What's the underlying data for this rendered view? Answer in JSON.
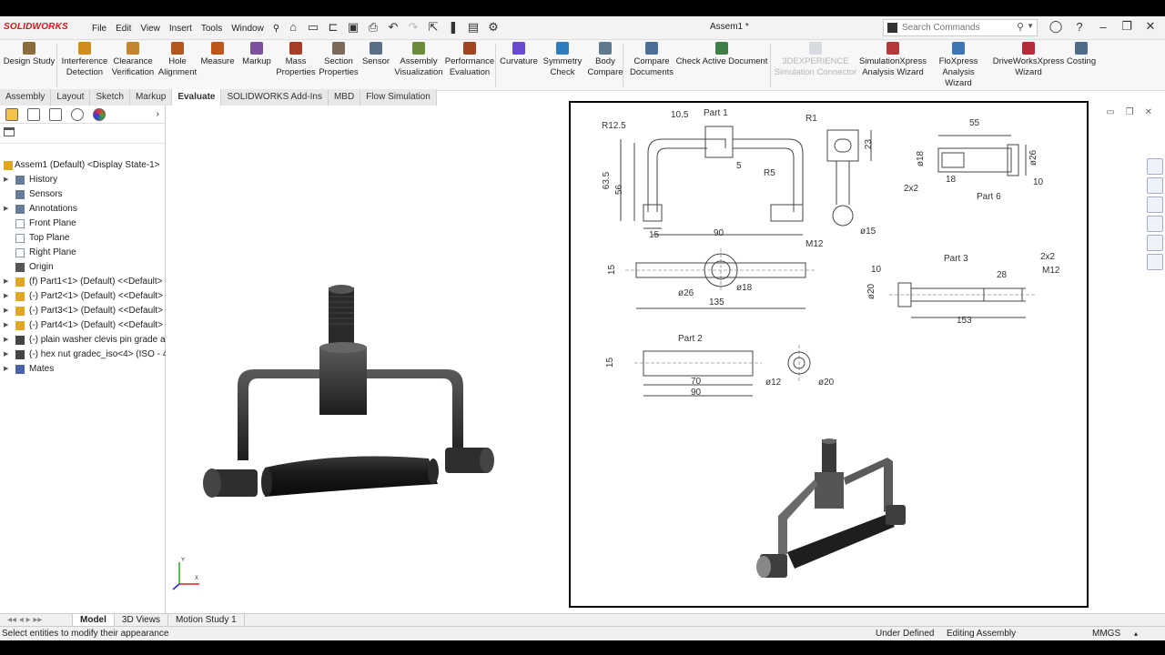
{
  "app": {
    "brand": "SOLIDWORKS",
    "document_title": "Assem1 *"
  },
  "menus": [
    "File",
    "Edit",
    "View",
    "Insert",
    "Tools",
    "Window"
  ],
  "search": {
    "placeholder": "Search Commands"
  },
  "commands": [
    {
      "label": "Design Study",
      "color": "#8a6d3b"
    },
    {
      "label": "Interference Detection",
      "color": "#d08a1e"
    },
    {
      "label": "Clearance Verification",
      "color": "#c4862a"
    },
    {
      "label": "Hole Alignment",
      "color": "#b2571e"
    },
    {
      "label": "Measure",
      "color": "#c0561a"
    },
    {
      "label": "Markup",
      "color": "#7e4f9e"
    },
    {
      "label": "Mass Properties",
      "color": "#aa3b24"
    },
    {
      "label": "Section Properties",
      "color": "#7b6a5b"
    },
    {
      "label": "Sensor",
      "color": "#5a6f85"
    },
    {
      "label": "Assembly Visualization",
      "color": "#6c8c3c"
    },
    {
      "label": "Performance Evaluation",
      "color": "#a04520"
    },
    {
      "label": "Curvature",
      "color": "#6a4ad0"
    },
    {
      "label": "Symmetry Check",
      "color": "#2e7dbf"
    },
    {
      "label": "Body Compare",
      "color": "#5f7a8e"
    },
    {
      "label": "Compare Documents",
      "color": "#4b6e99"
    },
    {
      "label": "Check Active Document",
      "color": "#3f7e45"
    },
    {
      "label": "3DEXPERIENCE Simulation Connector",
      "color": "#9aa7b5",
      "disabled": true
    },
    {
      "label": "SimulationXpress Analysis Wizard",
      "color": "#b43a3a"
    },
    {
      "label": "FloXpress Analysis Wizard",
      "color": "#3a77b4"
    },
    {
      "label": "DriveWorksXpress Wizard",
      "color": "#b42c3a"
    },
    {
      "label": "Costing",
      "color": "#4e6b8a"
    }
  ],
  "tabs": [
    "Assembly",
    "Layout",
    "Sketch",
    "Markup",
    "Evaluate",
    "SOLIDWORKS Add-Ins",
    "MBD",
    "Flow Simulation"
  ],
  "active_tab": "Evaluate",
  "tree": [
    {
      "label": "Assem1 (Default) <Display State-1>",
      "indent": 0,
      "arrow": false,
      "icon": "assembly-icon"
    },
    {
      "label": "History",
      "indent": 1,
      "arrow": true,
      "icon": "history-icon"
    },
    {
      "label": "Sensors",
      "indent": 1,
      "arrow": false,
      "icon": "sensors-icon"
    },
    {
      "label": "Annotations",
      "indent": 1,
      "arrow": true,
      "icon": "annotations-icon"
    },
    {
      "label": "Front Plane",
      "indent": 1,
      "arrow": false,
      "icon": "plane-icon"
    },
    {
      "label": "Top Plane",
      "indent": 1,
      "arrow": false,
      "icon": "plane-icon"
    },
    {
      "label": "Right Plane",
      "indent": 1,
      "arrow": false,
      "icon": "plane-icon"
    },
    {
      "label": "Origin",
      "indent": 1,
      "arrow": false,
      "icon": "origin-icon"
    },
    {
      "label": "(f) Part1<1> (Default) <<Default>",
      "indent": 1,
      "arrow": true,
      "icon": "part-icon"
    },
    {
      "label": "(-) Part2<1> (Default) <<Default>",
      "indent": 1,
      "arrow": true,
      "icon": "part-icon"
    },
    {
      "label": "(-) Part3<1> (Default) <<Default>",
      "indent": 1,
      "arrow": true,
      "icon": "part-icon"
    },
    {
      "label": "(-) Part4<1> (Default) <<Default>",
      "indent": 1,
      "arrow": true,
      "icon": "part-icon"
    },
    {
      "label": "(-) plain washer clevis pin grade a",
      "indent": 1,
      "arrow": true,
      "icon": "toolbox-icon"
    },
    {
      "label": "(-) hex nut gradec_iso<4> (ISO - 4",
      "indent": 1,
      "arrow": true,
      "icon": "toolbox-icon"
    },
    {
      "label": "Mates",
      "indent": 1,
      "arrow": true,
      "icon": "mates-icon"
    }
  ],
  "bottom_tabs": [
    "Model",
    "3D Views",
    "Motion Study 1"
  ],
  "active_bottom_tab": "Model",
  "status": {
    "message": "Select entities to modify their appearance",
    "definition": "Under Defined",
    "mode": "Editing Assembly",
    "units": "MMGS"
  },
  "drawing": {
    "part1": {
      "title": "Part 1",
      "dims": [
        "R12.5",
        "10.5",
        "R1",
        "5",
        "R5",
        "63.5",
        "56",
        "15",
        "90",
        "M12",
        "ø15",
        "23"
      ]
    },
    "part6": {
      "title": "Part 6",
      "dims": [
        "55",
        "ø18",
        "ø26",
        "2x2",
        "18",
        "10"
      ]
    },
    "center_view": {
      "dims": [
        "15",
        "ø26",
        "ø18",
        "135"
      ]
    },
    "part3": {
      "title": "Part 3",
      "dims": [
        "2x2",
        "10",
        "28",
        "M12",
        "ø20",
        "153"
      ]
    },
    "part2": {
      "title": "Part 2",
      "dims": [
        "15",
        "70",
        "90",
        "ø12",
        "ø20"
      ]
    }
  },
  "triad": {
    "x": "X",
    "y": "Y"
  }
}
